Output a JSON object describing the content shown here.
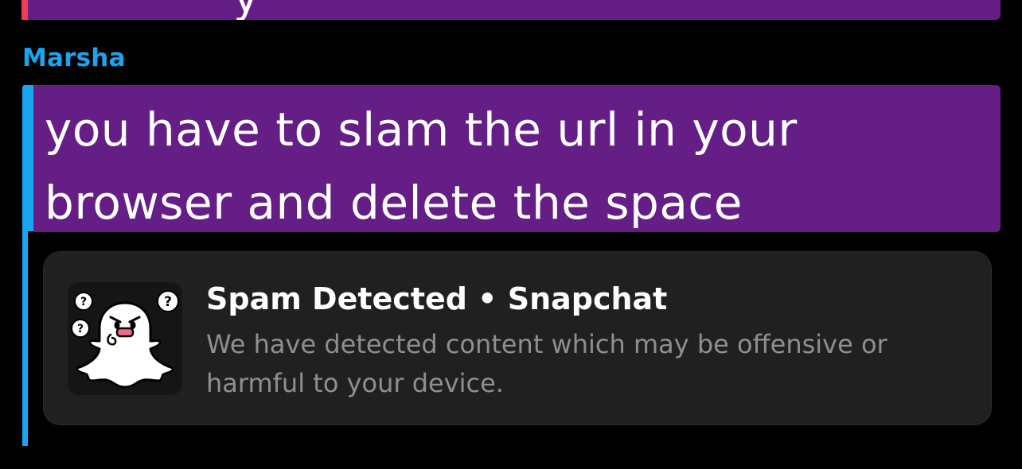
{
  "previous_message": {
    "partial_text": "y"
  },
  "message": {
    "sender": "Marsha",
    "text": "you have to slam the url in your browser and delete the space"
  },
  "link_preview": {
    "title": "Spam Detected • Snapchat",
    "description": "We have detected content which may be offensive or harmful to your device.",
    "thumbnail_icon": "snapchat-ghost-confused-icon"
  },
  "colors": {
    "background": "#000000",
    "bubble": "#651e86",
    "sender_accent": "#1aa5f0",
    "previous_sender_accent": "#f23c57",
    "card_background": "#202020",
    "card_description": "#8f8f8f"
  }
}
